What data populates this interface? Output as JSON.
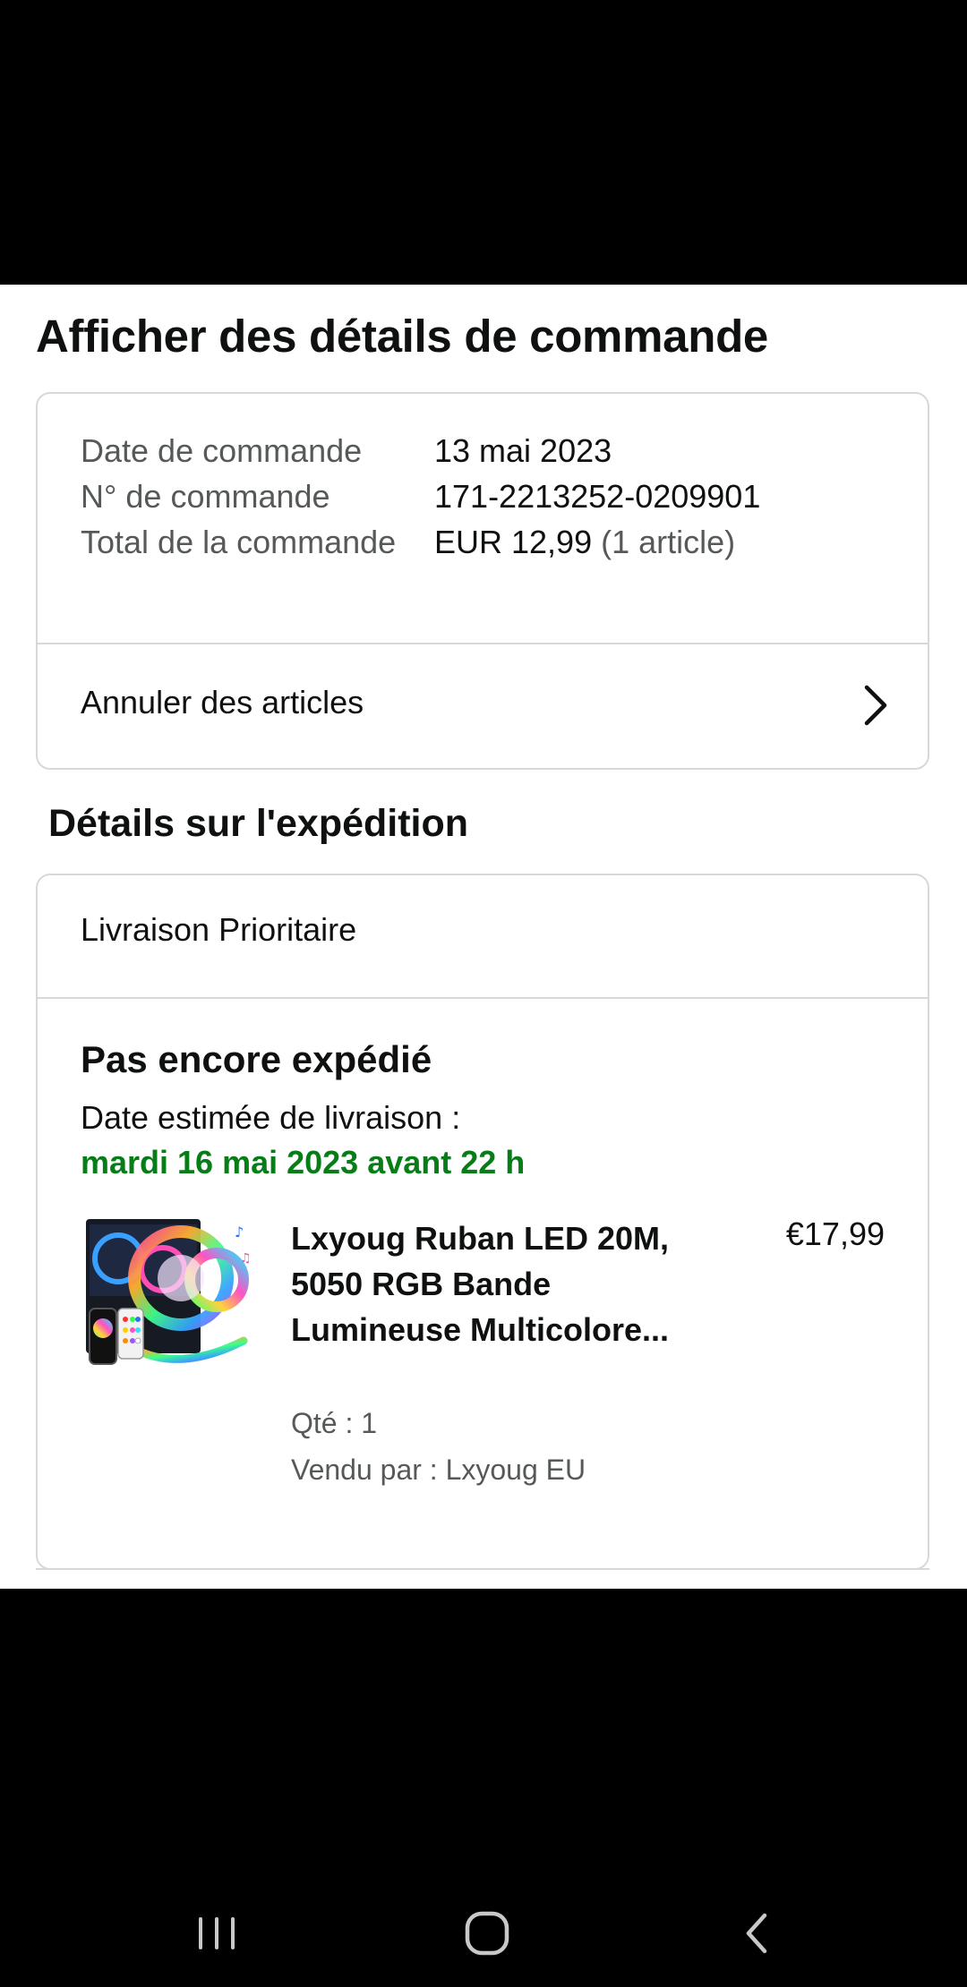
{
  "page": {
    "title": "Afficher des détails de commande"
  },
  "order_summary": {
    "rows": [
      {
        "label": "Date de commande",
        "value": "13 mai 2023"
      },
      {
        "label": "N° de commande",
        "value": "171-2213252-0209901"
      },
      {
        "label": "Total de la commande",
        "value": "EUR 12,99",
        "value_note": "(1 article)"
      }
    ],
    "cancel_label": "Annuler des articles"
  },
  "shipping": {
    "section_title": "Détails sur l'expédition",
    "method": "Livraison Prioritaire",
    "status": "Pas encore expédié",
    "eta_label": "Date estimée de livraison :",
    "eta_date": "mardi 16 mai 2023 avant 22 h",
    "eta_color": "#067d17"
  },
  "item": {
    "title": "Lxyoug Ruban LED 20M, 5050 RGB Bande Lumineuse Multicolore...",
    "price": "€17,99",
    "quantity": "Qté : 1",
    "seller": "Vendu par : Lxyoug EU",
    "image_icon": "led-strip-product-image"
  },
  "system_nav": {
    "buttons": [
      "recent-apps-icon",
      "home-icon",
      "back-icon"
    ]
  }
}
